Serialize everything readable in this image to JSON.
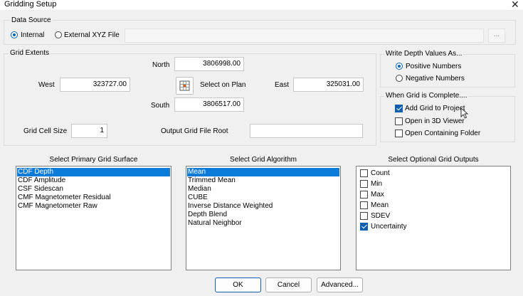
{
  "window": {
    "title": "Gridding Setup",
    "close": "✕"
  },
  "data_source": {
    "label": "Data Source",
    "internal_label": "Internal",
    "external_label": "External XYZ File",
    "selected": "Internal",
    "file_path": "",
    "browse_label": "..."
  },
  "grid_extents": {
    "label": "Grid Extents",
    "north_label": "North",
    "north_value": "3806998.00",
    "west_label": "West",
    "west_value": "323727.00",
    "east_label": "East",
    "east_value": "325031.00",
    "south_label": "South",
    "south_value": "3806517.00",
    "select_on_plan_label": "Select on Plan",
    "cell_size_label": "Grid Cell Size",
    "cell_size_value": "1",
    "file_root_label": "Output Grid File Root",
    "file_root_value": ""
  },
  "depth_values": {
    "label": "Write Depth Values As...",
    "positive_label": "Positive Numbers",
    "negative_label": "Negative Numbers",
    "selected": "Positive Numbers"
  },
  "when_complete": {
    "label": "When Grid is Complete....",
    "options": [
      {
        "label": "Add Grid to Project",
        "checked": true
      },
      {
        "label": "Open in 3D Viewer",
        "checked": false
      },
      {
        "label": "Open Containing Folder",
        "checked": false
      }
    ]
  },
  "primary_surface": {
    "label": "Select Primary Grid Surface",
    "items": [
      "CDF Depth",
      "CDF Amplitude",
      "CSF Sidescan",
      "CMF Magnetometer Residual",
      "CMF Magnetometer Raw"
    ],
    "selected": "CDF Depth"
  },
  "algorithm": {
    "label": "Select Grid Algorithm",
    "items": [
      "Mean",
      "Trimmed Mean",
      "Median",
      "CUBE",
      "Inverse Distance Weighted",
      "Depth Blend",
      "Natural Neighbor"
    ],
    "selected": "Mean"
  },
  "optional_outputs": {
    "label": "Select Optional Grid Outputs",
    "items": [
      {
        "label": "Count",
        "checked": false
      },
      {
        "label": "Min",
        "checked": false
      },
      {
        "label": "Max",
        "checked": false
      },
      {
        "label": "Mean",
        "checked": false
      },
      {
        "label": "SDEV",
        "checked": false
      },
      {
        "label": "Uncertainty",
        "checked": true
      }
    ]
  },
  "buttons": {
    "ok": "OK",
    "cancel": "Cancel",
    "advanced": "Advanced..."
  },
  "colors": {
    "accent": "#0a5fb0",
    "selection": "#0a7bd8",
    "background": "#f0f0f0"
  }
}
